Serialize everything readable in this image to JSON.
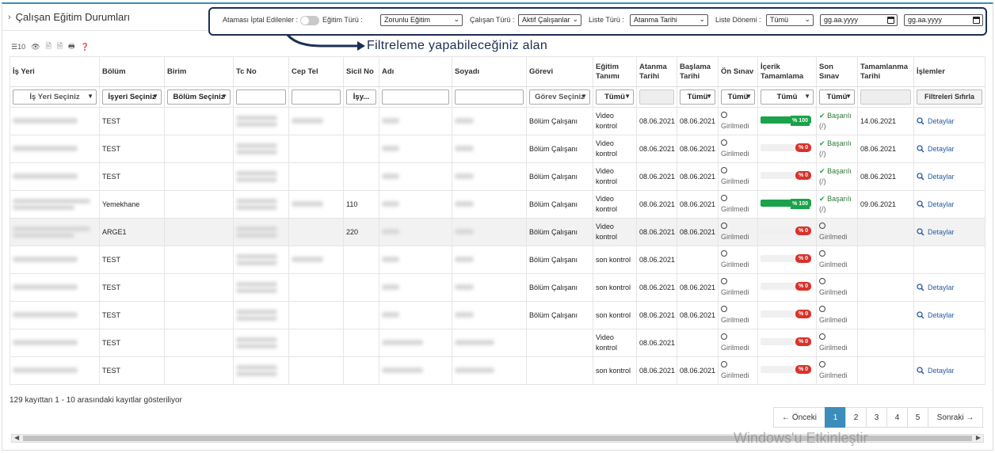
{
  "page": {
    "title": "Çalışan Eğitim Durumları",
    "annotation": "Filtreleme yapabileceğiniz alan",
    "watermark": "Windows'u Etkinleştir"
  },
  "filters": {
    "cancelled_label": "Ataması İptal Edilenler :",
    "training_type_label": "Eğitim Türü :",
    "training_type_value": "Zorunlu Eğitim",
    "employee_type_label": "Çalışan Türü :",
    "employee_type_value": "Aktif Çalışanlar",
    "list_type_label": "Liste Türü :",
    "list_type_value": "Atanma Tarihi",
    "list_period_label": "Liste Dönemi :",
    "list_period_value": "Tümü",
    "date_start_placeholder": "gg.aa.yyyy",
    "date_end_placeholder": "gg.aa.yyyy"
  },
  "toolbar": {
    "page_size": "10"
  },
  "table": {
    "headers": [
      "İş Yeri",
      "Bölüm",
      "Birim",
      "Tc No",
      "Cep Tel",
      "Sicil No",
      "Adı",
      "Soyadı",
      "Görevi",
      "Eğitim Tanımı",
      "Atanma Tarihi",
      "Başlama Tarihi",
      "Ön Sınav",
      "İçerik Tamamlama",
      "Son Sınav",
      "Tamamlanma Tarihi",
      "İşlemler"
    ],
    "filter_row": {
      "isyeri": "İş Yeri Seçiniz",
      "bolum": "İşyeri Seçiniz",
      "birim": "Bölüm Seçiniz",
      "sicil": "İşy...",
      "gorev": "Görev Seçiniz",
      "egitim": "Tümü",
      "basla": "Tümü",
      "onsinav": "Tümü",
      "icerik": "Tümü",
      "sonsinav": "Tümü",
      "reset": "Filtreleri Sıfırla"
    },
    "rows": [
      {
        "bolum": "TEST",
        "sicil": "",
        "gorev": "Bölüm Çalışanı",
        "egitim": "Video kontrol",
        "atanma": "08.06.2021",
        "baslama": "08.06.2021",
        "onsinav": "Girilmedi",
        "progress": 100,
        "progress_label": "% 100",
        "son_status": "Başarılı",
        "son_sub": "(/)",
        "tamamlanma": "14.06.2021",
        "islem": "Detaylar"
      },
      {
        "bolum": "TEST",
        "sicil": "",
        "gorev": "Bölüm Çalışanı",
        "egitim": "Video kontrol",
        "atanma": "08.06.2021",
        "baslama": "08.06.2021",
        "onsinav": "Girilmedi",
        "progress": 0,
        "progress_label": "% 0",
        "son_status": "Başarılı",
        "son_sub": "(/)",
        "tamamlanma": "08.06.2021",
        "islem": "Detaylar"
      },
      {
        "bolum": "TEST",
        "sicil": "",
        "gorev": "Bölüm Çalışanı",
        "egitim": "Video kontrol",
        "atanma": "08.06.2021",
        "baslama": "08.06.2021",
        "onsinav": "Girilmedi",
        "progress": 0,
        "progress_label": "% 0",
        "son_status": "Başarılı",
        "son_sub": "(/)",
        "tamamlanma": "08.06.2021",
        "islem": "Detaylar"
      },
      {
        "bolum": "Yemekhane",
        "sicil": "110",
        "gorev": "Bölüm Çalışanı",
        "egitim": "Video kontrol",
        "atanma": "08.06.2021",
        "baslama": "08.06.2021",
        "onsinav": "Girilmedi",
        "progress": 100,
        "progress_label": "% 100",
        "son_status": "Başarılı",
        "son_sub": "(/)",
        "tamamlanma": "09.06.2021",
        "islem": "Detaylar"
      },
      {
        "bolum": "ARGE1",
        "sicil": "220",
        "gorev": "Bölüm Çalışanı",
        "egitim": "Video kontrol",
        "atanma": "08.06.2021",
        "baslama": "08.06.2021",
        "onsinav": "Girilmedi",
        "progress": 0,
        "progress_label": "% 0",
        "son_status": "Girilmedi",
        "son_sub": "",
        "tamamlanma": "",
        "islem": "Detaylar"
      },
      {
        "bolum": "TEST",
        "sicil": "",
        "gorev": "Bölüm Çalışanı",
        "egitim": "son kontrol",
        "atanma": "08.06.2021",
        "baslama": "",
        "onsinav": "Girilmedi",
        "progress": 0,
        "progress_label": "% 0",
        "son_status": "Girilmedi",
        "son_sub": "",
        "tamamlanma": "",
        "islem": ""
      },
      {
        "bolum": "TEST",
        "sicil": "",
        "gorev": "Bölüm Çalışanı",
        "egitim": "son kontrol",
        "atanma": "08.06.2021",
        "baslama": "08.06.2021",
        "onsinav": "Girilmedi",
        "progress": 0,
        "progress_label": "% 0",
        "son_status": "Girilmedi",
        "son_sub": "",
        "tamamlanma": "",
        "islem": "Detaylar"
      },
      {
        "bolum": "TEST",
        "sicil": "",
        "gorev": "Bölüm Çalışanı",
        "egitim": "son kontrol",
        "atanma": "08.06.2021",
        "baslama": "08.06.2021",
        "onsinav": "Girilmedi",
        "progress": 0,
        "progress_label": "% 0",
        "son_status": "Girilmedi",
        "son_sub": "",
        "tamamlanma": "",
        "islem": "Detaylar"
      },
      {
        "bolum": "TEST",
        "sicil": "",
        "gorev": "",
        "egitim": "Video kontrol",
        "atanma": "08.06.2021",
        "baslama": "",
        "onsinav": "Girilmedi",
        "progress": 0,
        "progress_label": "% 0",
        "son_status": "Girilmedi",
        "son_sub": "",
        "tamamlanma": "",
        "islem": ""
      },
      {
        "bolum": "TEST",
        "sicil": "",
        "gorev": "",
        "egitim": "son kontrol",
        "atanma": "08.06.2021",
        "baslama": "08.06.2021",
        "onsinav": "Girilmedi",
        "progress": 0,
        "progress_label": "% 0",
        "son_status": "Girilmedi",
        "son_sub": "",
        "tamamlanma": "",
        "islem": "Detaylar"
      }
    ]
  },
  "footer": {
    "info": "129 kayıttan 1 - 10 arasındaki kayıtlar gösteriliyor",
    "prev": "← Önceki",
    "next": "Sonraki →",
    "pages": [
      "1",
      "2",
      "3",
      "4",
      "5"
    ]
  },
  "colors": {
    "accent": "#3c8dbc",
    "success": "#1aa34a",
    "danger": "#d9322b",
    "annotation": "#1d2f52"
  }
}
